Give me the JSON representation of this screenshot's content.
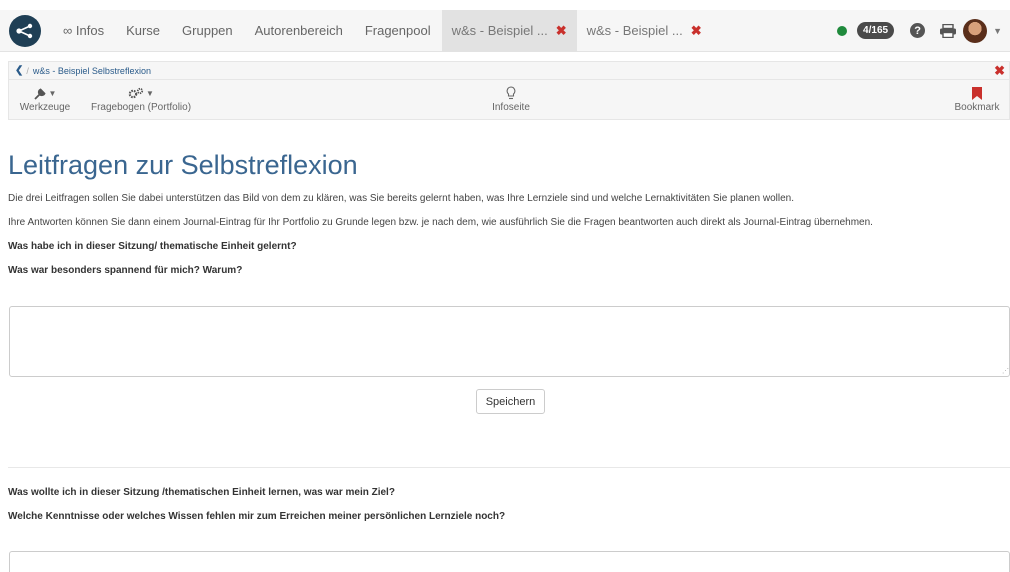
{
  "nav": {
    "items": [
      "∞ Infos",
      "Kurse",
      "Gruppen",
      "Autorenbereich",
      "Fragenpool"
    ],
    "tabs": [
      {
        "label": "w&s - Beispiel ...",
        "active": true
      },
      {
        "label": "w&s - Beispiel ...",
        "active": false
      }
    ],
    "close_glyph": "✖",
    "status_color": "#1f8a3c",
    "counter": "4/165",
    "help_glyph": "?"
  },
  "breadcrumb": {
    "back_glyph": "❮",
    "separator": "/",
    "current": "w&s - Beispiel Selbstreflexion",
    "close_glyph": "✖"
  },
  "toolbar": {
    "tools": "Werkzeuge",
    "questionnaire": "Fragebogen (Portfolio)",
    "info": "Infoseite",
    "bookmark": "Bookmark"
  },
  "content": {
    "title": "Leitfragen zur Selbstreflexion",
    "intro1": "Die drei Leitfragen sollen Sie dabei unterstützen das Bild von dem zu klären, was Sie bereits gelernt haben, was Ihre Lernziele sind und welche Lernaktivitäten Sie planen wollen.",
    "intro2": "Ihre Antworten können Sie dann einem Journal-Eintrag für Ihr Portfolio zu Grunde legen bzw. je nach dem, wie ausführlich Sie die Fragen beantworten auch direkt als Journal-Eintrag übernehmen.",
    "q1": "Was habe ich in dieser Sitzung/ thematische Einheit gelernt?",
    "q2": "Was war besonders spannend für mich? Warum?",
    "answer1": "",
    "save": "Speichern",
    "q3": "Was wollte ich in dieser Sitzung /thematischen Einheit lernen, was war mein Ziel?",
    "q4": "Welche Kenntnisse oder welches Wissen fehlen mir zum Erreichen meiner persönlichen Lernziele noch?",
    "answer2": ""
  },
  "colors": {
    "accent": "#3a6690",
    "danger": "#c9302c",
    "logo": "#1f3f55"
  }
}
